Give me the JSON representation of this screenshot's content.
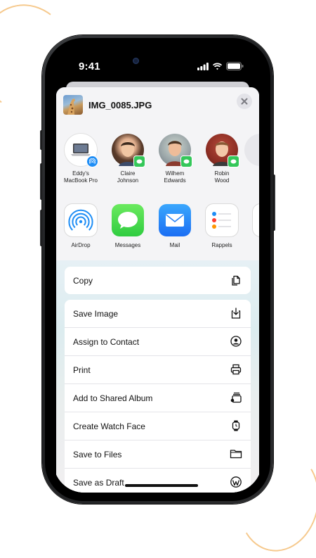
{
  "status_bar": {
    "time": "9:41"
  },
  "share_sheet": {
    "file_name": "IMG_0085.JPG",
    "people": [
      {
        "name": "Eddy's\nMacBook Pro",
        "type": "airdrop-device"
      },
      {
        "name": "Claire\nJohnson",
        "type": "messages"
      },
      {
        "name": "Wilhem\nEdwards",
        "type": "messages"
      },
      {
        "name": "Robin\nWood",
        "type": "messages"
      }
    ],
    "apps": [
      {
        "label": "AirDrop",
        "icon": "airdrop-icon"
      },
      {
        "label": "Messages",
        "icon": "messages-icon"
      },
      {
        "label": "Mail",
        "icon": "mail-icon"
      },
      {
        "label": "Rappels",
        "icon": "reminders-icon"
      }
    ],
    "copy_label": "Copy",
    "actions": [
      {
        "label": "Save Image",
        "icon": "save-image-icon"
      },
      {
        "label": "Assign to Contact",
        "icon": "contact-icon"
      },
      {
        "label": "Print",
        "icon": "printer-icon"
      },
      {
        "label": "Add to Shared Album",
        "icon": "shared-album-icon"
      },
      {
        "label": "Create Watch Face",
        "icon": "watch-icon"
      },
      {
        "label": "Save to Files",
        "icon": "folder-icon"
      },
      {
        "label": "Save as Draft",
        "icon": "wordpress-icon"
      }
    ]
  }
}
